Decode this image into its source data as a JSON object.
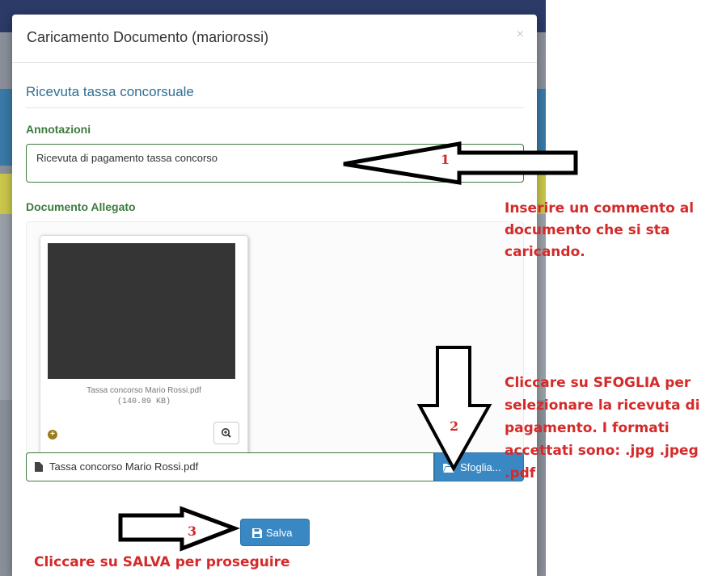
{
  "modal": {
    "title": "Caricamento Documento (mariorossi)",
    "close_label": "×",
    "section_title": "Ricevuta tassa concorsuale",
    "annotations_label": "Annotazioni",
    "annotations_value": "Ricevuta di pagamento tassa concorso",
    "document_label": "Documento Allegato",
    "preview": {
      "remove_label": "×",
      "caption": "Tassa concorso Mario Rossi.pdf",
      "size": "(140.89 KB)",
      "add_icon": "plus-circle-icon",
      "zoom_icon": "zoom-in-icon"
    },
    "file_input_value": "Tassa concorso Mario Rossi.pdf",
    "browse_label": "Sfoglia...",
    "save_label": "Salva"
  },
  "annotations": {
    "step1_number": "1",
    "step1_text": "Inserire un commento al documento che si sta caricando.",
    "step2_number": "2",
    "step2_text": "Cliccare su SFOGLIA per selezionare la ricevuta di pagamento. I formati accettati sono: .jpg .jpeg .pdf",
    "step3_number": "3",
    "step3_text": "Cliccare su SALVA per proseguire"
  },
  "colors": {
    "primary_button": "#3a88c3",
    "label_green": "#3c7a3c",
    "title_blue": "#2f6f92",
    "annotation_red": "#d42a2a"
  }
}
